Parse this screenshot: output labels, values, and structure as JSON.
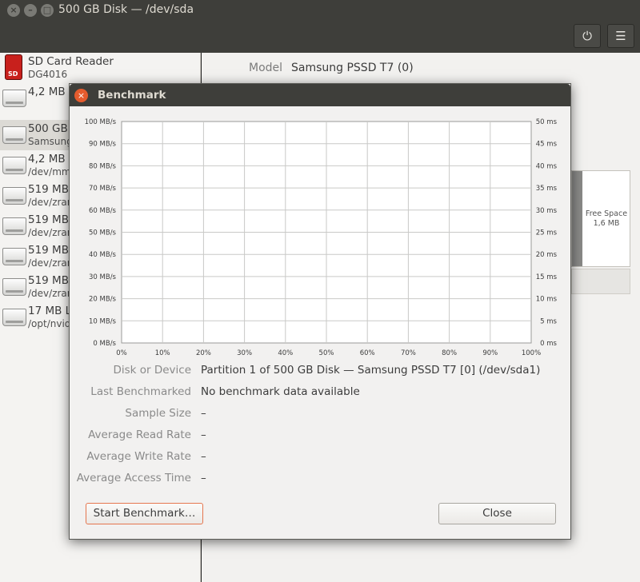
{
  "window": {
    "title": "500 GB Disk — /dev/sda",
    "controls": [
      "×",
      "–",
      "□"
    ]
  },
  "header": {
    "power_icon": "power-icon",
    "menu_icon": "hamburger-menu-icon",
    "power_glyph": "⏻",
    "menu_glyph": "☰"
  },
  "sidebar": {
    "devices": [
      {
        "name": "SD Card Reader",
        "sub": "DG4016",
        "icon": "sd-card-icon"
      },
      {
        "name": "4,2 MB ",
        "sub": "",
        "icon": "drive-icon"
      },
      {
        "name": "500 GB ",
        "sub": "Samsung",
        "icon": "drive-icon",
        "selected": true
      },
      {
        "name": "4,2 MB ",
        "sub": "/dev/mm",
        "icon": "drive-icon"
      },
      {
        "name": "519 MB",
        "sub": "/dev/zrar",
        "icon": "drive-icon"
      },
      {
        "name": "519 MB",
        "sub": "/dev/zrar",
        "icon": "drive-icon"
      },
      {
        "name": "519 MB",
        "sub": "/dev/zrar",
        "icon": "drive-icon"
      },
      {
        "name": "519 MB",
        "sub": "/dev/zrar",
        "icon": "drive-icon"
      },
      {
        "name": "17 MB L",
        "sub": "/opt/nvid",
        "icon": "drive-icon"
      }
    ]
  },
  "main": {
    "model_label": "Model",
    "model_value": "Samsung PSSD T7 (0)",
    "free_space_label": "Free Space",
    "free_space_value": "1,6 MB"
  },
  "dialog": {
    "title": "Benchmark",
    "close_glyph": "×",
    "properties": [
      {
        "label": "Disk or Device",
        "value": "Partition 1 of 500 GB Disk — Samsung PSSD T7 [0] (/dev/sda1)"
      },
      {
        "label": "Last Benchmarked",
        "value": "No benchmark data available"
      },
      {
        "label": "Sample Size",
        "value": "–"
      },
      {
        "label": "Average Read Rate",
        "value": "–"
      },
      {
        "label": "Average Write Rate",
        "value": "–"
      },
      {
        "label": "Average Access Time",
        "value": "–"
      }
    ],
    "start_button": "Start Benchmark…",
    "close_button": "Close"
  },
  "chart_data": {
    "type": "line",
    "x_ticks": [
      "0%",
      "10%",
      "20%",
      "30%",
      "40%",
      "50%",
      "60%",
      "70%",
      "80%",
      "90%",
      "100%"
    ],
    "y_left_ticks": [
      "0 MB/s",
      "10 MB/s",
      "20 MB/s",
      "30 MB/s",
      "40 MB/s",
      "50 MB/s",
      "60 MB/s",
      "70 MB/s",
      "80 MB/s",
      "90 MB/s",
      "100 MB/s"
    ],
    "y_right_ticks": [
      "0 ms",
      "5 ms",
      "10 ms",
      "15 ms",
      "20 ms",
      "25 ms",
      "30 ms",
      "35 ms",
      "40 ms",
      "45 ms",
      "50 ms"
    ],
    "xlim": [
      0,
      100
    ],
    "ylim_left": [
      0,
      100
    ],
    "ylim_right": [
      0,
      50
    ],
    "grid": true,
    "series": []
  }
}
